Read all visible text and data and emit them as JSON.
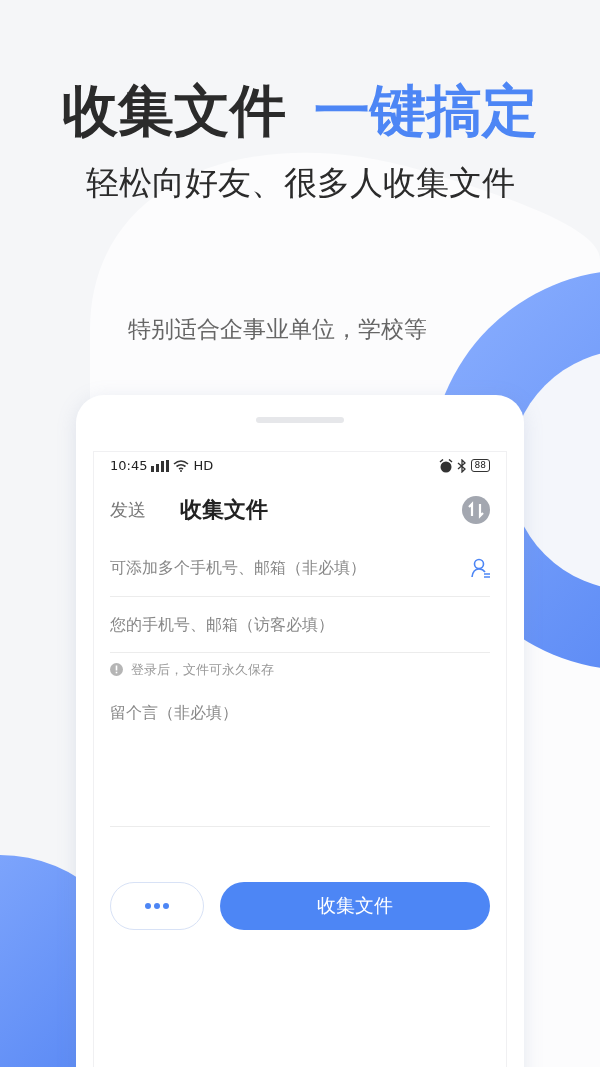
{
  "headline": {
    "main": "收集文件",
    "accent": "一键搞定"
  },
  "subtitle": "轻松向好友、很多人收集文件",
  "tagline": "特别适合企事业单位，学校等",
  "phone": {
    "status_bar": {
      "time": "10:45",
      "network": "HD",
      "battery": "88"
    },
    "tabs": [
      {
        "label": "发送",
        "selected": false
      },
      {
        "label": "收集文件",
        "selected": true
      }
    ],
    "fields": [
      {
        "kind": "contacts",
        "placeholder": "可添加多个手机号、邮箱（非必填）"
      },
      {
        "kind": "plain",
        "placeholder": "您的手机号、邮箱（访客必填）"
      }
    ],
    "hint": "登录后，文件可永久保存",
    "message": {
      "placeholder": "留个言（非必填）"
    },
    "primary_button": "收集文件"
  }
}
